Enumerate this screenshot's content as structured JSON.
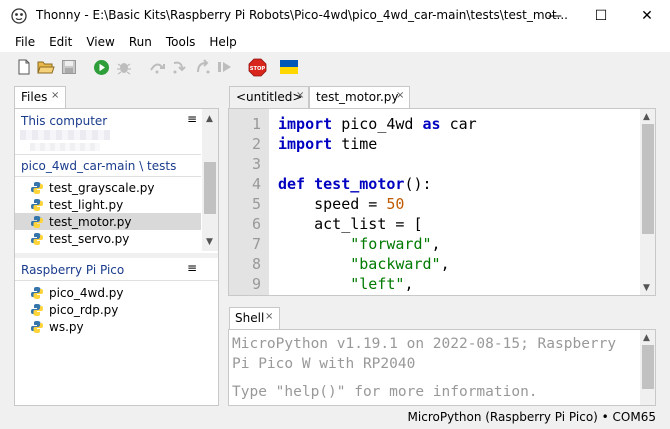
{
  "window": {
    "title": "Thonny  -  E:\\Basic Kits\\Raspberry Pi Robots\\Pico-4wd\\pico_4wd_car-main\\tests\\test_mot...",
    "minimize_glyph": "—",
    "maximize_glyph": "☐",
    "close_glyph": "✕"
  },
  "menu": [
    "File",
    "Edit",
    "View",
    "Run",
    "Tools",
    "Help"
  ],
  "toolbar": {
    "icons": [
      "new-file-icon",
      "open-file-icon",
      "save-icon",
      "run-icon",
      "debug-icon",
      "step-over-icon",
      "step-into-icon",
      "step-out-icon",
      "resume-icon",
      "stop-icon",
      "ukraine-flag-icon"
    ],
    "stop_label": "STOP",
    "colors": {
      "run": "#2e9e3a",
      "stop": "#d9261c",
      "flag_blue": "#0057b7",
      "flag_yellow": "#ffd700"
    }
  },
  "files": {
    "tab_label": "Files",
    "tab_close": "×",
    "local": {
      "title": "This computer",
      "menu_glyph": "≡",
      "path": "pico_4wd_car-main \\ tests",
      "items": [
        "test_grayscale.py",
        "test_light.py",
        "test_motor.py",
        "test_servo.py"
      ],
      "selected": "test_motor.py"
    },
    "remote": {
      "title": "Raspberry Pi Pico",
      "menu_glyph": "≡",
      "items": [
        "pico_4wd.py",
        "pico_rdp.py",
        "ws.py"
      ]
    }
  },
  "editor": {
    "tabs": [
      {
        "label": "<untitled>",
        "close": "×"
      },
      {
        "label": "test_motor.py",
        "close": "×"
      }
    ],
    "line_numbers": [
      "1",
      "2",
      "3",
      "4",
      "5",
      "6",
      "7",
      "8",
      "9"
    ],
    "code": {
      "l1_kw1": "import",
      "l1_mid": " pico_4wd ",
      "l1_kw2": "as",
      "l1_rest": " car",
      "l2_kw": "import",
      "l2_rest": " time",
      "l4_kw": "def",
      "l4_fn": "test_motor",
      "l4_rest": "():",
      "l5_pre": "    speed = ",
      "l5_num": "50",
      "l6": "    act_list = [",
      "l7_pre": "        ",
      "l7_str": "\"forward\"",
      "l7_post": ",",
      "l8_pre": "        ",
      "l8_str": "\"backward\"",
      "l8_post": ",",
      "l9_pre": "        ",
      "l9_str": "\"left\"",
      "l9_post": ","
    }
  },
  "shell": {
    "tab_label": "Shell",
    "tab_close": "×",
    "line1": "MicroPython v1.19.1 on 2022-08-15; Raspberry",
    "line2": "Pi Pico W with RP2040",
    "line3": "Type \"help()\" for more information."
  },
  "status": {
    "text": "MicroPython (Raspberry Pi Pico)  •  COM65"
  }
}
